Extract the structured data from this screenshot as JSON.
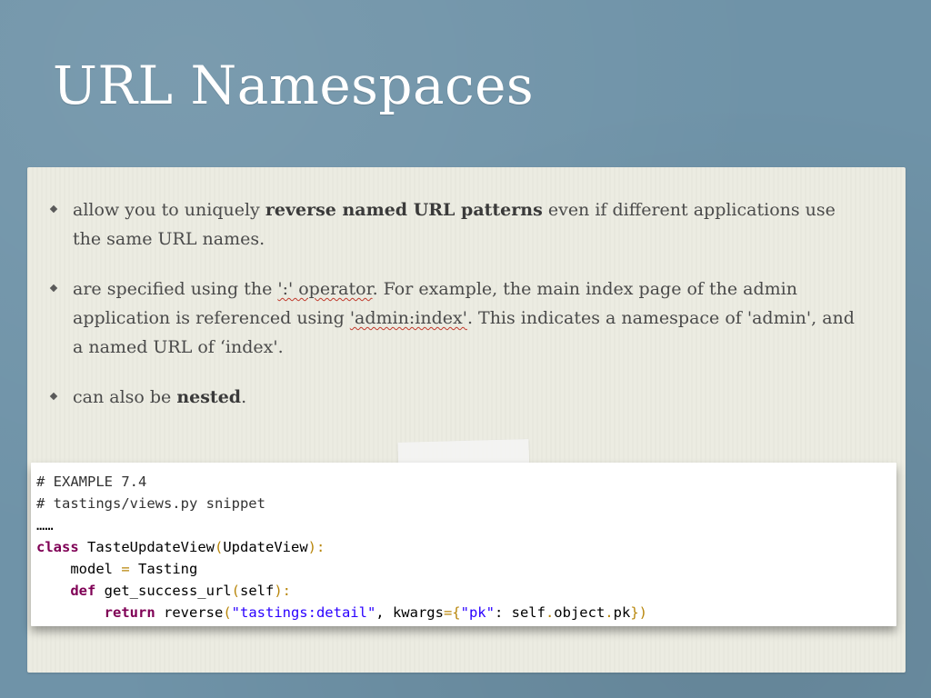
{
  "slide": {
    "title": "URL Namespaces"
  },
  "bullets": [
    {
      "segments": [
        {
          "text": "allow you to uniquely ",
          "style": "normal"
        },
        {
          "text": "reverse named URL patterns",
          "style": "bold"
        },
        {
          "text": " even if different applications use the same URL names.",
          "style": "normal"
        }
      ]
    },
    {
      "segments": [
        {
          "text": "are specified using the ",
          "style": "normal"
        },
        {
          "text": "':' operator",
          "style": "underline-red"
        },
        {
          "text": ". For example, the main index page of the admin application is referenced using ",
          "style": "normal"
        },
        {
          "text": "'admin:index'",
          "style": "underline-red"
        },
        {
          "text": ". This indicates a namespace of 'admin', and a named URL of ‘index'.",
          "style": "normal"
        }
      ]
    },
    {
      "segments": [
        {
          "text": "can also be ",
          "style": "normal"
        },
        {
          "text": "nested",
          "style": "bold"
        },
        {
          "text": ".",
          "style": "normal"
        }
      ]
    }
  ],
  "code": {
    "lines": [
      [
        {
          "t": "# EXAMPLE 7.4",
          "c": "cm"
        }
      ],
      [
        {
          "t": "# tastings/views.py snippet",
          "c": "cm"
        }
      ],
      [
        {
          "t": "……",
          "c": ""
        }
      ],
      [
        {
          "t": "class",
          "c": "kw"
        },
        {
          "t": " TasteUpdateView",
          "c": ""
        },
        {
          "t": "(",
          "c": "op"
        },
        {
          "t": "UpdateView",
          "c": ""
        },
        {
          "t": "):",
          "c": "op"
        }
      ],
      [
        {
          "t": "    model ",
          "c": ""
        },
        {
          "t": "=",
          "c": "op"
        },
        {
          "t": " Tasting",
          "c": ""
        }
      ],
      [
        {
          "t": "    ",
          "c": ""
        },
        {
          "t": "def",
          "c": "kw"
        },
        {
          "t": " get_success_url",
          "c": ""
        },
        {
          "t": "(",
          "c": "op"
        },
        {
          "t": "self",
          "c": ""
        },
        {
          "t": "):",
          "c": "op"
        }
      ],
      [
        {
          "t": "        ",
          "c": ""
        },
        {
          "t": "return",
          "c": "kw"
        },
        {
          "t": " reverse",
          "c": ""
        },
        {
          "t": "(",
          "c": "op"
        },
        {
          "t": "\"tastings:detail\"",
          "c": "st"
        },
        {
          "t": ", kwargs",
          "c": ""
        },
        {
          "t": "={",
          "c": "op"
        },
        {
          "t": "\"pk\"",
          "c": "st"
        },
        {
          "t": ": self",
          "c": ""
        },
        {
          "t": ".",
          "c": "op"
        },
        {
          "t": "object",
          "c": ""
        },
        {
          "t": ".",
          "c": "op"
        },
        {
          "t": "pk",
          "c": ""
        },
        {
          "t": "})",
          "c": "op"
        }
      ]
    ]
  }
}
